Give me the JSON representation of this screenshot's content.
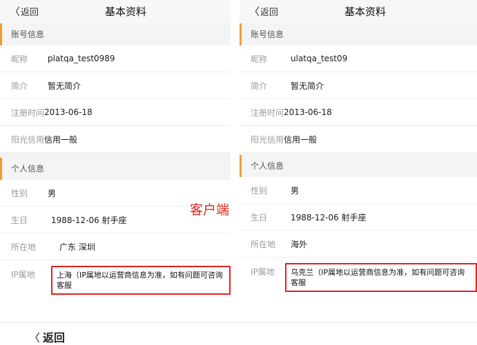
{
  "annotation": "客户端",
  "bottom_back": {
    "chevron": "〈",
    "label": "返回"
  },
  "panels": [
    {
      "back_chevron": "〈",
      "back_label": "返回",
      "title": "基本资料",
      "account_section": "账号信息",
      "nickname_label": "昵称",
      "nickname_value": "platqa_test0989",
      "intro_label": "简介",
      "intro_value": "暂无简介",
      "reg_label": "注册时间",
      "reg_value": "2013-06-18",
      "credit_label": "阳光信用",
      "credit_value": "信用一般",
      "personal_section": "个人信息",
      "gender_label": "性别",
      "gender_value": "男",
      "birthday_label": "生日",
      "birthday_value": "1988-12-06 射手座",
      "location_label": "所在地",
      "location_value": "广东 深圳",
      "ip_label": "IP属地",
      "ip_value": "上海（IP属地以运营商信息为准，如有问题可咨询客服"
    },
    {
      "back_chevron": "〈",
      "back_label": "返回",
      "title": "基本资料",
      "account_section": "账号信息",
      "nickname_label": "昵称",
      "nickname_value": "ulatqa_test09",
      "intro_label": "简介",
      "intro_value": "暂无简介",
      "reg_label": "注册时间",
      "reg_value": "2013-06-18",
      "credit_label": "阳光信用",
      "credit_value": "信用一般",
      "personal_section": "个人信息",
      "gender_label": "性别",
      "gender_value": "男",
      "birthday_label": "生日",
      "birthday_value": "1988-12-06 射手座",
      "location_label": "所在地",
      "location_value": "海外",
      "ip_label": "IP属地",
      "ip_value": "乌克兰（IP属地以运营商信息为准，如有问题可咨询客服"
    }
  ],
  "colors": {
    "accent": "#f39c2c",
    "highlight": "#e0211b"
  }
}
